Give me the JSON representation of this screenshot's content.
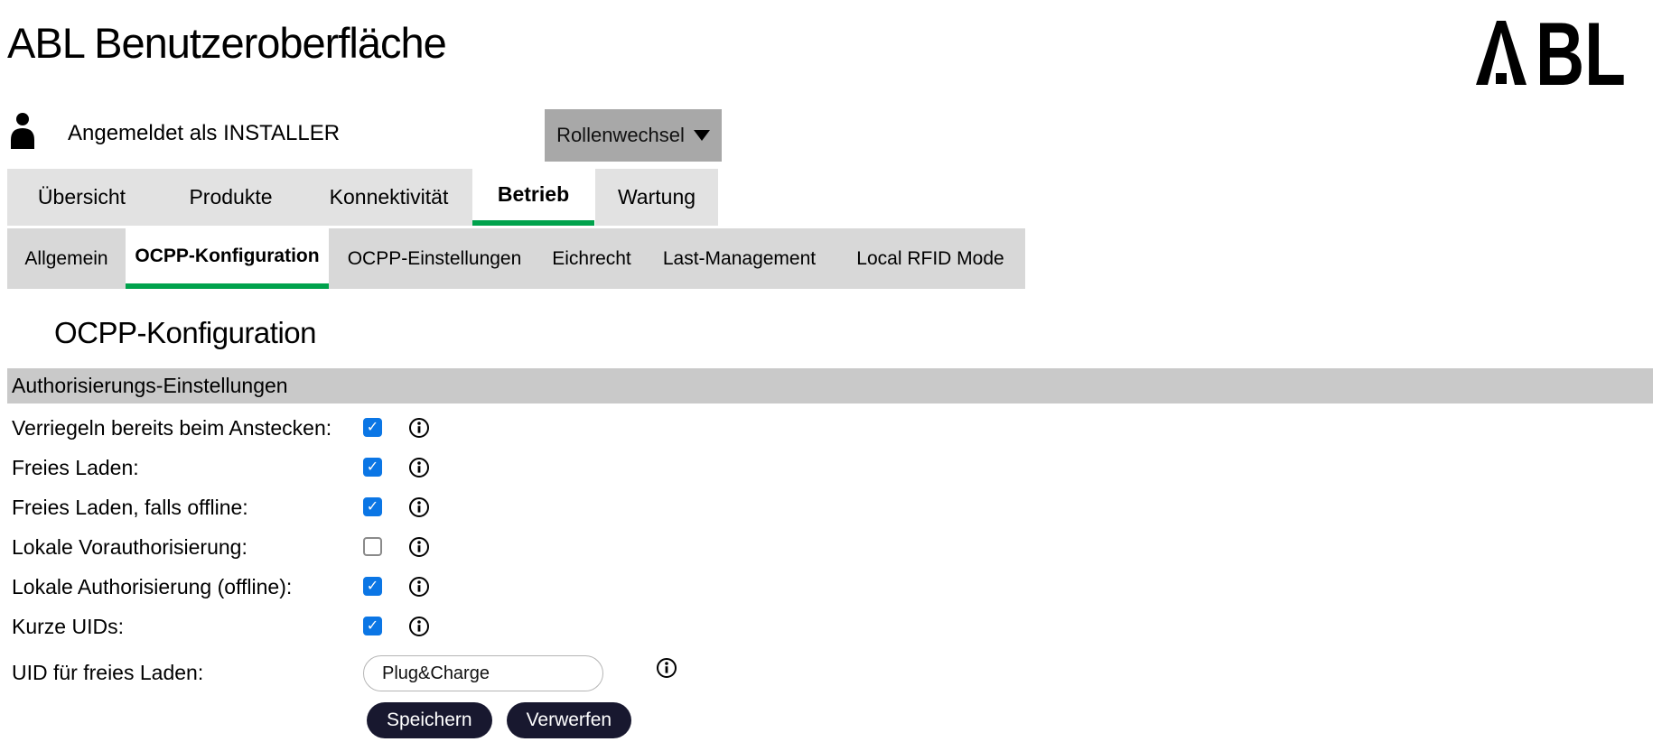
{
  "header": {
    "title": "ABL Benutzeroberfläche",
    "logo_text": "ABL"
  },
  "user_bar": {
    "logged_in_text": "Angemeldet als INSTALLER",
    "role_button_label": "Rollenwechsel",
    "role_button_icon": "caret-down-icon",
    "user_icon": "person-icon"
  },
  "main_tabs": {
    "active": "Betrieb",
    "items": [
      {
        "label": "Übersicht",
        "active": false
      },
      {
        "label": "Produkte",
        "active": false
      },
      {
        "label": "Konnektivität",
        "active": false
      },
      {
        "label": "Betrieb",
        "active": true
      },
      {
        "label": "Wartung",
        "active": false
      }
    ]
  },
  "sub_tabs": {
    "active": "OCPP-Konfiguration",
    "items": [
      {
        "label": "Allgemein",
        "active": false
      },
      {
        "label": "OCPP-Konfiguration",
        "active": true
      },
      {
        "label": "OCPP-Einstellungen",
        "active": false
      },
      {
        "label": "Eichrecht",
        "active": false
      },
      {
        "label": "Last-Management",
        "active": false
      },
      {
        "label": "Local RFID Mode",
        "active": false
      }
    ]
  },
  "page": {
    "heading": "OCPP-Konfiguration"
  },
  "section": {
    "title": "Authorisierungs-Einstellungen"
  },
  "form": {
    "rows": [
      {
        "label": "Verriegeln bereits beim Anstecken:",
        "type": "checkbox",
        "checked": true,
        "info_icon": "info-icon"
      },
      {
        "label": "Freies Laden:",
        "type": "checkbox",
        "checked": true,
        "info_icon": "info-icon"
      },
      {
        "label": "Freies Laden, falls offline:",
        "type": "checkbox",
        "checked": true,
        "info_icon": "info-icon"
      },
      {
        "label": "Lokale Vorauthorisierung:",
        "type": "checkbox",
        "checked": false,
        "info_icon": "info-icon"
      },
      {
        "label": "Lokale Authorisierung (offline):",
        "type": "checkbox",
        "checked": true,
        "info_icon": "info-icon"
      },
      {
        "label": "Kurze UIDs:",
        "type": "checkbox",
        "checked": true,
        "info_icon": "info-icon"
      },
      {
        "label": "UID für freies Laden:",
        "type": "text",
        "value": "Plug&Charge",
        "info_icon": "info-icon"
      }
    ],
    "actions": {
      "save_label": "Speichern",
      "discard_label": "Verwerfen"
    }
  },
  "colors": {
    "accent_green": "#00a24c",
    "checkbox_blue": "#0b76e5",
    "button_navy": "#18182f",
    "main_tab_gray": "#e2e2e2",
    "sub_tab_gray": "#d8d8d8",
    "role_button_gray": "#a8a8a8",
    "section_bar_gray": "#c9c9c9"
  }
}
